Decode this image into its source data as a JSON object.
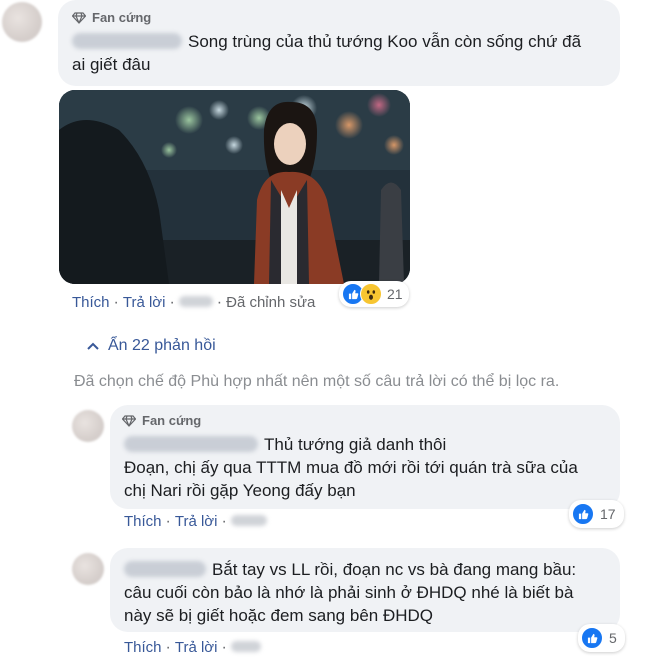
{
  "badge": {
    "label": "Fan cứng"
  },
  "comment1": {
    "text": "Song trùng của thủ tướng Koo vẫn còn sống chứ đã ai giết đâu",
    "line1": "Song trùng của thủ tướng Koo vẫn còn sống chứ đã",
    "line2": "ai giết đâu",
    "actions": {
      "like": "Thích",
      "reply": "Trả lời",
      "edited": "Đã chỉnh sửa"
    },
    "reactions": {
      "icons": [
        "like-icon",
        "wow-icon"
      ],
      "count": "21"
    }
  },
  "thread": {
    "hide_label": "Ẩn 22 phản hồi",
    "filter_notice": "Đã chọn chế độ Phù hợp nhất nên một số câu trả lời có thể bị lọc ra."
  },
  "reply1": {
    "line1": "Thủ tướng giả danh thôi",
    "line2": "Đoạn, chị ấy qua TTTM mua đồ mới rồi tới quán trà sữa của",
    "line3": "chị Nari rồi gặp Yeong đấy bạn",
    "actions": {
      "like": "Thích",
      "reply": "Trả lời"
    },
    "reactions": {
      "icons": [
        "like-icon"
      ],
      "count": "17"
    }
  },
  "reply2": {
    "line1": "Bắt tay vs LL rồi, đoạn nc vs bà đang mang bầu:",
    "line2": "câu cuối còn bảo là nhớ là phải sinh ở ĐHDQ nhé là biết bà",
    "line3": "này sẽ bị giết hoặc đem sang bên ĐHDQ",
    "actions": {
      "like": "Thích",
      "reply": "Trả lời"
    },
    "reactions": {
      "icons": [
        "like-icon"
      ],
      "count": "5"
    }
  },
  "colors": {
    "link": "#385898",
    "meta": "#65676b",
    "bubble": "#f0f2f5",
    "like": "#1877f2",
    "wow": "#f7c531"
  }
}
